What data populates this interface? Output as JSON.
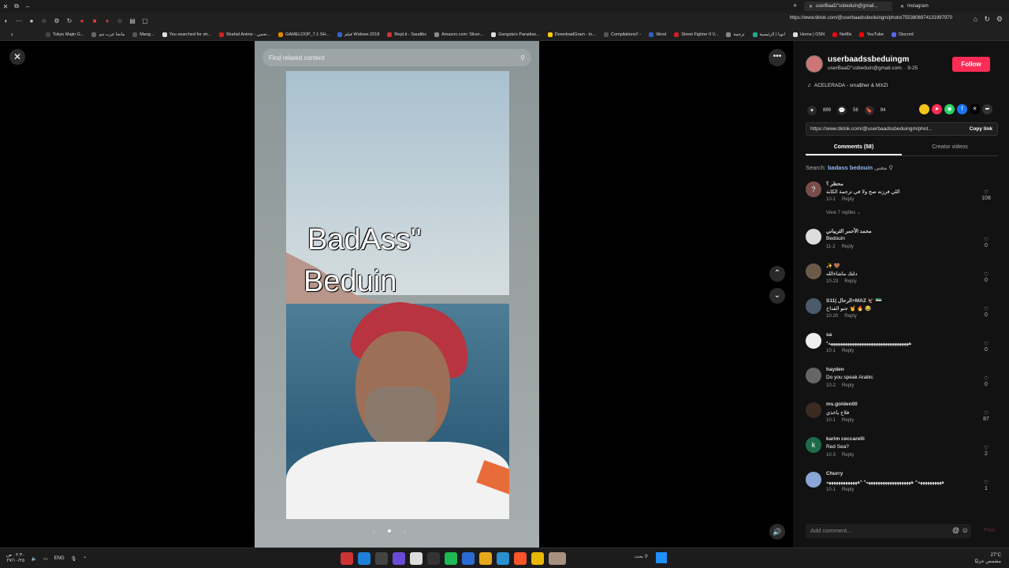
{
  "browser": {
    "tabs": [
      {
        "label": "userBaaD''ssbeduin@gmail..."
      },
      {
        "label": "Instagram"
      }
    ],
    "url": "https://www.tiktok.com/@userbaadssbeduingm/photo/7553806974131997970",
    "bookmarks": [
      "Tokyo Majin G...",
      "مانجا عرب تيم",
      "Mang...",
      "You searched for str...",
      "Shahid Anime - تحمي...",
      "GAMELOOP_7.1 SH...",
      "فيلم Widows 2018",
      "RepLit - Saudibc",
      "Amazon.com: Silver...",
      "Gangsta's Paradise...",
      "DownloadGram - In...",
      "Compilations!! -",
      "Word",
      "Street Fighter II V...",
      "ترجمة",
      "انويا | الرئيسية",
      "Home | OSN",
      "Netflix",
      "YouTube",
      "Discord"
    ]
  },
  "viewer": {
    "search_placeholder": "Find related content",
    "caption_line1": "BadAss\"",
    "caption_line2": "Beduin"
  },
  "panel": {
    "author_name": "userbaadssbeduingm",
    "author_sub": "userBaaD''ssbeduin@gmail.com. · 9-25",
    "follow_label": "Follow",
    "music": "ACELERADA - sma$her & MXZI",
    "likes": "889",
    "comments_count": "58",
    "saves": "94",
    "link": "https://www.tiktok.com/@userbaadssbeduingm/phot...",
    "copy_label": "Copy link",
    "tab_comments": "Comments (58)",
    "tab_creator": "Creator videos",
    "search_prefix": "Search:",
    "search_term": "badass bedouin",
    "search_suffix": "معنى",
    "comments": [
      {
        "avatar": "?",
        "name": "محظر ؟",
        "text": "اللي فرزته صح ولا في ترجمة الكابة",
        "date": "10-1",
        "reply": "Reply",
        "likes": "108",
        "view_replies": "View 7 replies ⌄"
      },
      {
        "avatar": "",
        "name": "محمد الأحمر الثريباني",
        "text": "Bedouin",
        "date": "11-2",
        "reply": "Reply",
        "likes": "0"
      },
      {
        "avatar": "",
        "name": "✨ 🤎",
        "text": "دلتك ماشاءالله",
        "date": "10-23",
        "reply": "Reply",
        "likes": "0"
      },
      {
        "avatar": "",
        "name": "S11| الرحال+MAZ 🦅 🇸🇾",
        "text": "جنو القداح 🤘 🔥 😂",
        "date": "10-20",
        "reply": "Reply",
        "likes": "0"
      },
      {
        "avatar": "",
        "name": "sa",
        "text": "*ههههههههههههههههههههههههههههههههههه",
        "date": "10-1",
        "reply": "Reply",
        "likes": "0"
      },
      {
        "avatar": "",
        "name": "hayden",
        "text": "Do you speak Arabic",
        "date": "10-2",
        "reply": "Reply",
        "likes": "0"
      },
      {
        "avatar": "",
        "name": "ms.golden00",
        "text": "فلاح ياخذي",
        "date": "10-1",
        "reply": "Reply",
        "likes": "87"
      },
      {
        "avatar": "k",
        "name": "karim ceccarelli",
        "text": "Red Sea?",
        "date": "10-3",
        "reply": "Reply",
        "likes": "2"
      },
      {
        "avatar": "",
        "name": "Churry",
        "text": "ههههههههههه^ هههههههههههههههههههه* ^هههههههههههههه",
        "date": "10-1",
        "reply": "Reply",
        "likes": "1"
      }
    ],
    "add_comment_placeholder": "Add comment...",
    "post_label": "Post"
  },
  "taskbar": {
    "lang": "ENG",
    "search_text": "بحث",
    "temp": "27°C",
    "weather": "مشمس جزئيًا",
    "clock_time": "٠٢:٣٠ ص",
    "clock_date": "٢٧/١٠/٢٥"
  },
  "colors": {
    "follow": "#fe2c55",
    "panel_bg": "#121212",
    "viewer_bg": "#000000",
    "search_term": "#8fb8f0"
  }
}
